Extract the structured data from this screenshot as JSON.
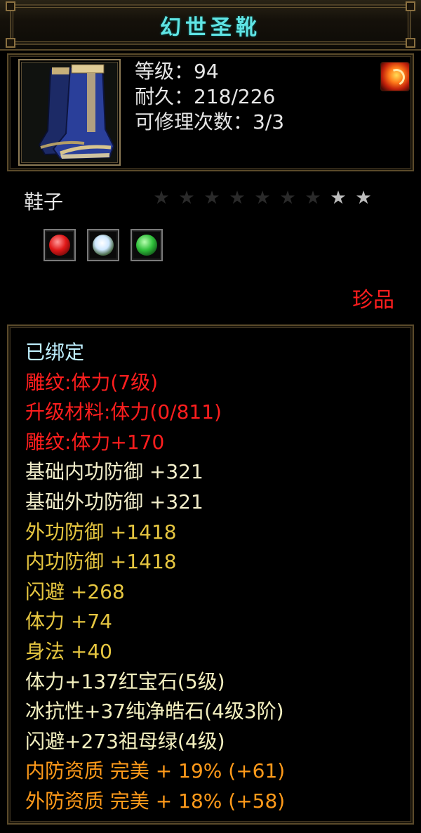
{
  "title": "幻世圣靴",
  "item": {
    "icon": "boots-icon",
    "level_line": "等级：94",
    "durability_line": "耐久：218/226",
    "repair_line": "可修理次数：3/3",
    "badge_icon": "fire-emblem-icon"
  },
  "type": {
    "label": "鞋子",
    "stars_total": 9,
    "stars_lit": 2
  },
  "gems": [
    {
      "icon": "ruby-gem-icon",
      "color": "#e01818"
    },
    {
      "icon": "diamond-gem-icon",
      "color": "#cfe8ff"
    },
    {
      "icon": "emerald-gem-icon",
      "color": "#2fbf3a"
    }
  ],
  "quality": "珍品",
  "attributes": [
    {
      "text": "已绑定",
      "color": "#bff0ff"
    },
    {
      "text": "雕纹:体力(7级)",
      "color": "#ff1e1e"
    },
    {
      "text": "升级材料:体力(0/811)",
      "color": "#ff1e1e"
    },
    {
      "text": "雕纹:体力+170",
      "color": "#ff1e1e"
    },
    {
      "text": "基础内功防御 +321",
      "color": "#f2eecb"
    },
    {
      "text": "基础外功防御 +321",
      "color": "#f2eecb"
    },
    {
      "text": "外功防御 +1418",
      "color": "#e6c640"
    },
    {
      "text": "内功防御 +1418",
      "color": "#e6c640"
    },
    {
      "text": "闪避 +268",
      "color": "#e6c640"
    },
    {
      "text": "体力 +74",
      "color": "#e6c640"
    },
    {
      "text": "身法 +40",
      "color": "#e6c640"
    },
    {
      "text": "体力+137红宝石(5级)",
      "color": "#f4f0c0"
    },
    {
      "text": "冰抗性+37纯净皓石(4级3阶)",
      "color": "#f4f0c0"
    },
    {
      "text": "闪避+273祖母绿(4级)",
      "color": "#f4f0c0"
    },
    {
      "text": "内防资质 完美 + 19% (+61)",
      "color": "#ff9a1a"
    },
    {
      "text": "外防资质 完美 + 18% (+58)",
      "color": "#ff9a1a"
    }
  ]
}
